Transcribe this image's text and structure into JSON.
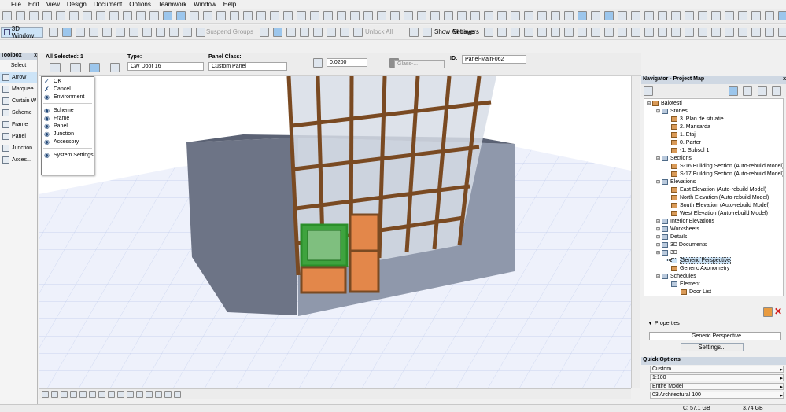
{
  "menu": [
    "File",
    "Edit",
    "View",
    "Design",
    "Document",
    "Options",
    "Teamwork",
    "Window",
    "Help"
  ],
  "toolbar2": {
    "window_tab": "3D Window",
    "suspend": "Suspend Groups",
    "unlock": "Unlock All",
    "settings": "Settings",
    "show_layers": "Show All Layers"
  },
  "toolbox": {
    "title": "Toolbox",
    "close": "x",
    "select": "Select",
    "items": [
      {
        "label": "Arrow",
        "sel": true
      },
      {
        "label": "Marquee"
      },
      {
        "label": "Curtain W"
      },
      {
        "label": "Scheme"
      },
      {
        "label": "Frame"
      },
      {
        "label": "Panel"
      },
      {
        "label": "Junction"
      },
      {
        "label": "Acces..."
      }
    ]
  },
  "info": {
    "selected": "All Selected: 1",
    "type_label": "Type:",
    "type_value": "CW Door 16",
    "class_label": "Panel Class:",
    "class_value": "Custom Panel",
    "thickness": "0.0200",
    "material": "Glass-...",
    "id_label": "ID:",
    "id_value": "Panel-Main-062"
  },
  "popup": {
    "ok": "OK",
    "cancel": "Cancel",
    "items": [
      "Environment",
      "Scheme",
      "Frame",
      "Panel",
      "Junction",
      "Accessory",
      "System Settings"
    ]
  },
  "navigator": {
    "title": "Navigator - Project Map",
    "tree": [
      {
        "t": "Balotesti",
        "lv": 0
      },
      {
        "t": "Stories",
        "lv": 1,
        "b": 1
      },
      {
        "t": "3. Plan de situatie",
        "lv": 2
      },
      {
        "t": "2. Mansarda",
        "lv": 2
      },
      {
        "t": "1. Etaj",
        "lv": 2
      },
      {
        "t": "0. Parter",
        "lv": 2
      },
      {
        "t": "-1. Subsol 1",
        "lv": 2
      },
      {
        "t": "Sections",
        "lv": 1,
        "b": 1
      },
      {
        "t": "S-16 Building Section (Auto-rebuild Model)",
        "lv": 2
      },
      {
        "t": "S-17 Building Section (Auto-rebuild Model)",
        "lv": 2
      },
      {
        "t": "Elevations",
        "lv": 1,
        "b": 1
      },
      {
        "t": "East Elevation (Auto-rebuild Model)",
        "lv": 2
      },
      {
        "t": "North Elevation (Auto-rebuild Model)",
        "lv": 2
      },
      {
        "t": "South Elevation (Auto-rebuild Model)",
        "lv": 2
      },
      {
        "t": "West Elevation (Auto-rebuild Model)",
        "lv": 2
      },
      {
        "t": "Interior Elevations",
        "lv": 1,
        "b": 1
      },
      {
        "t": "Worksheets",
        "lv": 1,
        "b": 1
      },
      {
        "t": "Details",
        "lv": 1,
        "b": 1
      },
      {
        "t": "3D Documents",
        "lv": 1,
        "b": 1
      },
      {
        "t": "3D",
        "lv": 1,
        "b": 1
      },
      {
        "t": "Generic Perspective",
        "lv": 2,
        "sel": 1
      },
      {
        "t": "Generic Axonometry",
        "lv": 2
      },
      {
        "t": "Schedules",
        "lv": 1,
        "b": 1
      },
      {
        "t": "Element",
        "lv": 2,
        "b": 1
      },
      {
        "t": "Door List",
        "lv": 3
      }
    ]
  },
  "properties": {
    "title": "Properties",
    "value": "Generic Perspective",
    "button": "Settings..."
  },
  "quick": {
    "title": "Quick Options",
    "rows": [
      "Custom",
      "1:100",
      "Entire Model",
      "03 Architectural 100"
    ]
  },
  "status": {
    "disk": "C: 57.1 GB",
    "ram": "3.74 GB"
  },
  "colors": {
    "accent": "#9cc6ec",
    "frame": "#7a4a22"
  }
}
